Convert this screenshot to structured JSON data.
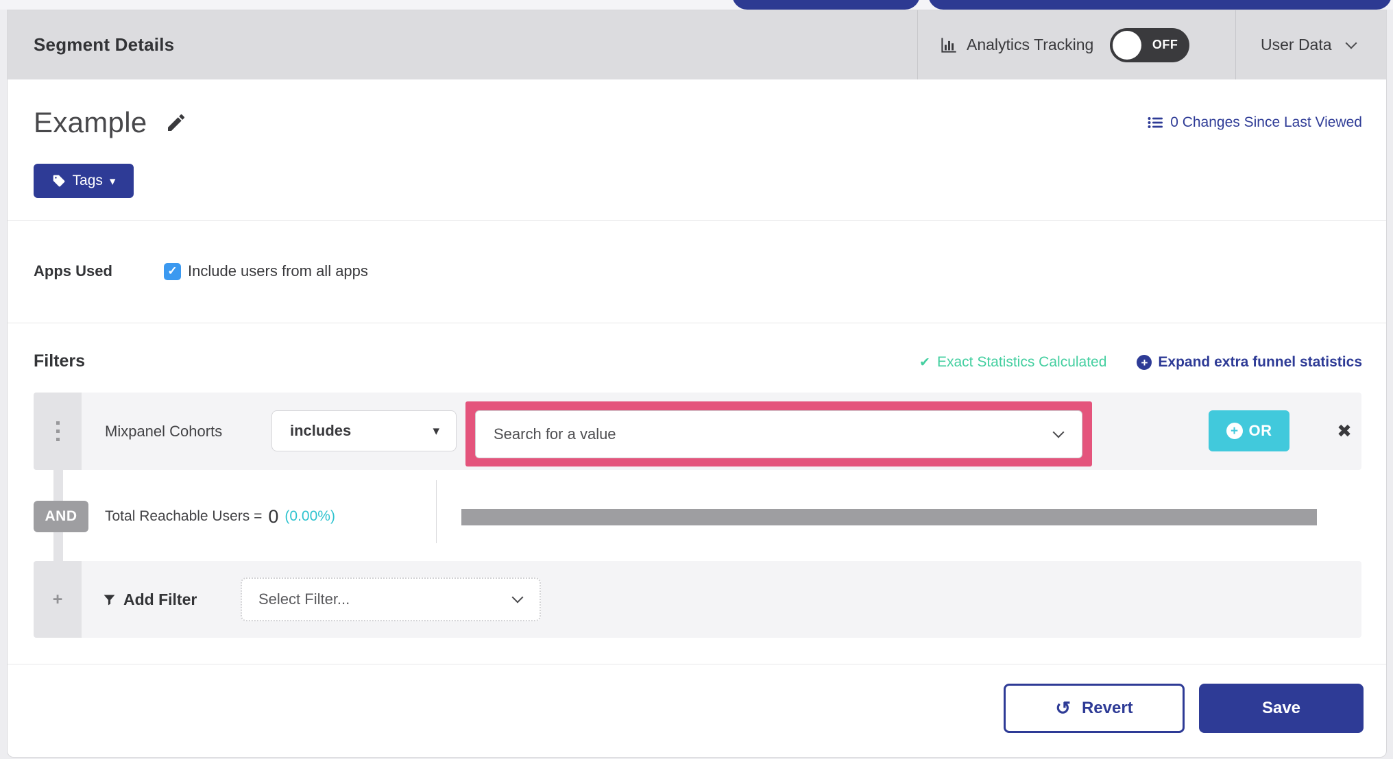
{
  "colors": {
    "accent_blue": "#2e3b96",
    "teal_or": "#41c9dc",
    "green_exact": "#44cfa0",
    "cyan_percent": "#2fc3cf",
    "pink_highlight": "#e4547c",
    "checkbox_blue": "#3b99f0",
    "header_gray": "#dcdcdf",
    "row_gray": "#f4f4f6",
    "badge_gray": "#9e9ea1"
  },
  "header": {
    "title": "Segment Details",
    "analytics_tracking": {
      "label": "Analytics Tracking",
      "toggle_state": "OFF"
    },
    "user_data": {
      "label": "User Data"
    }
  },
  "segment": {
    "name": "Example",
    "changes_link": "0 Changes Since Last Viewed",
    "tags_button_label": "Tags"
  },
  "apps_used": {
    "label": "Apps Used",
    "checkbox_label": "Include users from all apps",
    "checked": true
  },
  "filters": {
    "heading": "Filters",
    "status": {
      "exact": "Exact Statistics Calculated",
      "expand": "Expand extra funnel statistics"
    },
    "rows": [
      {
        "field": "Mixpanel Cohorts",
        "operator": "includes",
        "value_placeholder": "Search for a value",
        "or_button_label": "OR"
      }
    ],
    "conjunction": "AND",
    "reachable": {
      "label": "Total Reachable Users =",
      "value": "0",
      "percent": "(0.00%)"
    },
    "add_filter": {
      "label": "Add Filter",
      "select_placeholder": "Select Filter..."
    }
  },
  "footer": {
    "revert_label": "Revert",
    "save_label": "Save"
  },
  "icons": {
    "caret_down": "▾",
    "close": "✖",
    "check": "✔",
    "checkbox_check": "✓",
    "plus": "+",
    "revert_arrow": "↺"
  }
}
